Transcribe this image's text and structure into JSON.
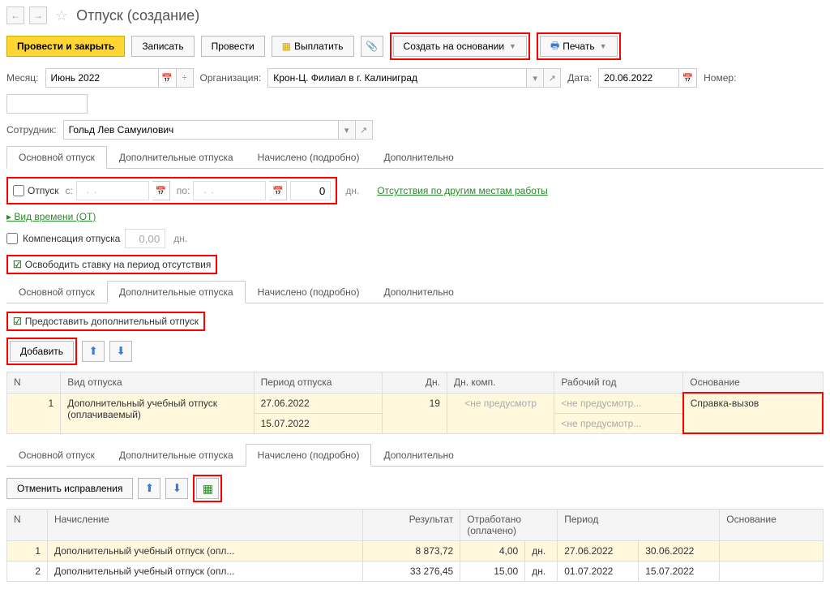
{
  "header": {
    "title": "Отпуск (создание)"
  },
  "toolbar": {
    "post_close": "Провести и закрыть",
    "save": "Записать",
    "post": "Провести",
    "pay": "Выплатить",
    "create_based": "Создать на основании",
    "print": "Печать"
  },
  "form": {
    "month_label": "Месяц:",
    "month_value": "Июнь 2022",
    "org_label": "Организация:",
    "org_value": "Крон-Ц. Филиал в г. Калиниград",
    "date_label": "Дата:",
    "date_value": "20.06.2022",
    "number_label": "Номер:",
    "number_value": "",
    "employee_label": "Сотрудник:",
    "employee_value": "Гольд Лев Самуилович"
  },
  "tabs": {
    "main": "Основной отпуск",
    "additional": "Дополнительные отпуска",
    "accrued": "Начислено (подробно)",
    "extra": "Дополнительно"
  },
  "main_section": {
    "vacation_label": "Отпуск",
    "from_label": "с:",
    "to_label": "по:",
    "days_value": "0",
    "days_suffix": "дн.",
    "absence_link": "Отсутствия по другим местам работы",
    "time_type": "Вид времени (ОТ)",
    "compensation_label": "Компенсация отпуска",
    "compensation_value": "0,00",
    "compensation_suffix": "дн.",
    "release_rate": "Освободить ставку на период отсутствия"
  },
  "additional_section": {
    "provide_label": "Предоставить дополнительный отпуск",
    "add_btn": "Добавить",
    "headers": {
      "n": "N",
      "type": "Вид отпуска",
      "period": "Период отпуска",
      "days": "Дн.",
      "comp_days": "Дн. комп.",
      "work_year": "Рабочий год",
      "basis": "Основание"
    },
    "rows": [
      {
        "n": "1",
        "type": "Дополнительный учебный отпуск (оплачиваемый)",
        "period_from": "27.06.2022",
        "period_to": "15.07.2022",
        "days": "19",
        "comp_days": "<не предусмотр",
        "work_year1": "<не предусмотр...",
        "work_year2": "<не предусмотр...",
        "basis": "Справка-вызов"
      }
    ]
  },
  "accrued_section": {
    "cancel_fix": "Отменить исправления",
    "headers": {
      "n": "N",
      "accrual": "Начисление",
      "result": "Результат",
      "worked": "Отработано (оплачено)",
      "period": "Период",
      "basis": "Основание"
    },
    "rows": [
      {
        "n": "1",
        "accrual": "Дополнительный учебный отпуск (опл...",
        "result": "8 873,72",
        "worked": "4,00",
        "worked_suffix": "дн.",
        "period_from": "27.06.2022",
        "period_to": "30.06.2022"
      },
      {
        "n": "2",
        "accrual": "Дополнительный учебный отпуск (опл...",
        "result": "33 276,45",
        "worked": "15,00",
        "worked_suffix": "дн.",
        "period_from": "01.07.2022",
        "period_to": "15.07.2022"
      }
    ]
  }
}
